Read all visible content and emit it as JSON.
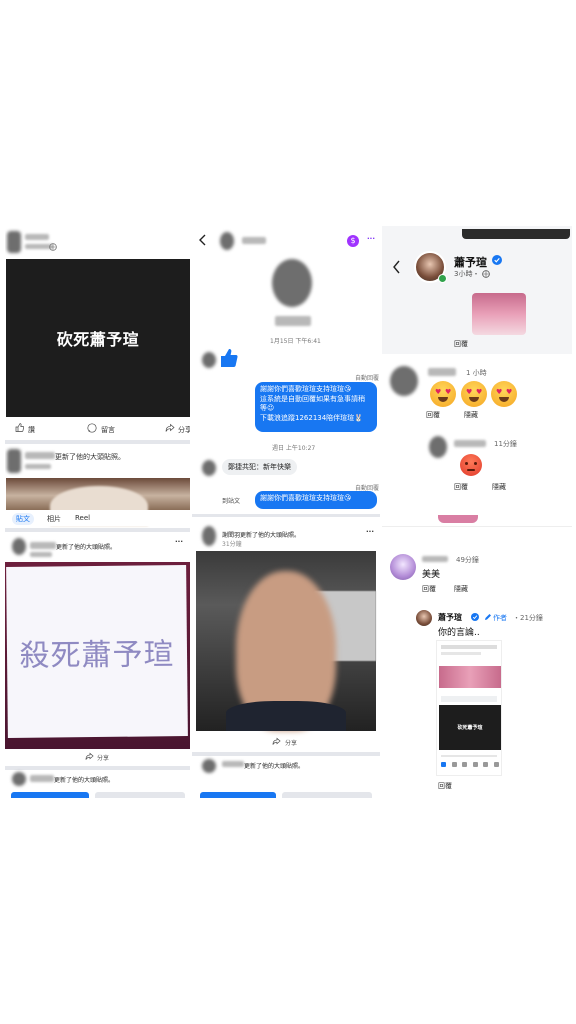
{
  "panel1": {
    "post1": {
      "banner_text": "砍死蕭予瑄",
      "actions": [
        "讚",
        "留言",
        "分享"
      ]
    },
    "post2_caption": "更新了他的大頭貼照。",
    "tabs": [
      "貼文",
      "相片",
      "Reel"
    ],
    "post3": {
      "caption": "更新了他的大頭貼照。",
      "paper_text": "殺死蕭予瑄",
      "share_label": "分享"
    },
    "post4_caption": "更新了他的大頭貼照。"
  },
  "panel2": {
    "date_line": "1月15日 下午6:41",
    "auto_reply_label_1": "自動回覆",
    "auto_reply_lines": [
      "謝謝你們喜歡瑄瑄支持瑄瑄😘",
      "這系統是自動回覆如果有急事請稍",
      "等😉",
      "下載浪追蹤1262134陪伴瑄瑄🐰"
    ],
    "link_text": "1262134",
    "weekday_line": "週日 上午10:27",
    "greeting": "鄭捷共犯：新年快樂",
    "auto_reply_label_2": "自動回覆",
    "auto_reply_line_2": "謝謝你們喜歡瑄瑄支持瑄瑄😘",
    "truncated_top": "到站文",
    "post_caption": "謝閎羽更新了他的大頭貼照。",
    "post_time": "31分鐘",
    "share_label": "分享",
    "post2_caption": "更新了他的大頭貼照。"
  },
  "panel3": {
    "author_name": "蕭予瑄",
    "author_time": "3小時・",
    "reply_1": "回覆",
    "comment1": {
      "time": "1 小時",
      "reply": "回覆",
      "hide": "隱藏"
    },
    "comment2": {
      "time": "11分鐘",
      "reply": "回覆",
      "hide": "隱藏"
    },
    "comment3": {
      "time": "49分鐘",
      "text": "美美",
      "reply": "回覆",
      "hide": "隱藏"
    },
    "comment4": {
      "name": "蕭予瑄",
      "author_tag": "作者",
      "time": "・21分鐘",
      "text": "你的言論..",
      "thumb_title": "砍死蕭予瑄",
      "reply": "回覆"
    }
  },
  "colors": {
    "fb_blue": "#1877f2",
    "dark_banner": "#1d1d1d",
    "page_bg": "#ffffff",
    "separator": "#e4e6eb"
  }
}
